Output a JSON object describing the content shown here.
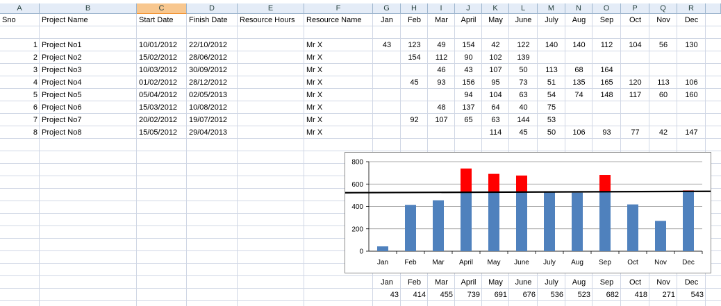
{
  "columns": [
    "A",
    "B",
    "C",
    "D",
    "E",
    "F",
    "G",
    "H",
    "I",
    "J",
    "K",
    "L",
    "M",
    "N",
    "O",
    "P",
    "Q",
    "R"
  ],
  "selected_column": "C",
  "header_row": [
    "Sno",
    "Project Name",
    "Start Date",
    "Finish Date",
    "Resource Hours",
    "Resource Name",
    "Jan",
    "Feb",
    "Mar",
    "April",
    "May",
    "June",
    "July",
    "Aug",
    "Sep",
    "Oct",
    "Nov",
    "Dec"
  ],
  "rows": [
    {
      "sno": "1",
      "name": "Project No1",
      "start": "10/01/2012",
      "finish": "22/10/2012",
      "res": "Mr X",
      "months": [
        "43",
        "123",
        "49",
        "154",
        "42",
        "122",
        "140",
        "140",
        "112",
        "104",
        "56",
        "130"
      ]
    },
    {
      "sno": "2",
      "name": "Project No2",
      "start": "15/02/2012",
      "finish": "28/06/2012",
      "res": "Mr X",
      "months": [
        "",
        "154",
        "112",
        "90",
        "102",
        "139",
        "",
        "",
        "",
        "",
        "",
        ""
      ]
    },
    {
      "sno": "3",
      "name": "Project No3",
      "start": "10/03/2012",
      "finish": "30/09/2012",
      "res": "Mr X",
      "months": [
        "",
        "",
        "46",
        "43",
        "107",
        "50",
        "113",
        "68",
        "164",
        "",
        "",
        ""
      ]
    },
    {
      "sno": "4",
      "name": "Project No4",
      "start": "01/02/2012",
      "finish": "28/12/2012",
      "res": "Mr X",
      "months": [
        "",
        "45",
        "93",
        "156",
        "95",
        "73",
        "51",
        "135",
        "165",
        "120",
        "113",
        "106"
      ]
    },
    {
      "sno": "5",
      "name": "Project No5",
      "start": "05/04/2012",
      "finish": "02/05/2013",
      "res": "Mr X",
      "months": [
        "",
        "",
        "",
        "94",
        "104",
        "63",
        "54",
        "74",
        "148",
        "117",
        "60",
        "160"
      ]
    },
    {
      "sno": "6",
      "name": "Project No6",
      "start": "15/03/2012",
      "finish": "10/08/2012",
      "res": "Mr X",
      "months": [
        "",
        "",
        "48",
        "137",
        "64",
        "40",
        "75",
        "",
        "",
        "",
        "",
        ""
      ]
    },
    {
      "sno": "7",
      "name": "Project No7",
      "start": "20/02/2012",
      "finish": "19/07/2012",
      "res": "Mr X",
      "months": [
        "",
        "92",
        "107",
        "65",
        "63",
        "144",
        "53",
        "",
        "",
        "",
        "",
        ""
      ]
    },
    {
      "sno": "8",
      "name": "Project No8",
      "start": "15/05/2012",
      "finish": "29/04/2013",
      "res": "Mr X",
      "months": [
        "",
        "",
        "",
        "",
        "114",
        "45",
        "50",
        "106",
        "93",
        "77",
        "42",
        "147"
      ]
    }
  ],
  "totals_labels": [
    "Jan",
    "Feb",
    "Mar",
    "April",
    "May",
    "June",
    "July",
    "Aug",
    "Sep",
    "Oct",
    "Nov",
    "Dec"
  ],
  "totals_values": [
    "43",
    "414",
    "455",
    "739",
    "691",
    "676",
    "536",
    "523",
    "682",
    "418",
    "271",
    "543"
  ],
  "colors": {
    "bar": "#4f81bd",
    "over": "#ff0000",
    "threshold_line": "#000000",
    "header_bg": "#e4ecf7",
    "selected_header": "#f8c78f"
  },
  "chart_data": {
    "type": "bar",
    "categories": [
      "Jan",
      "Feb",
      "Mar",
      "April",
      "May",
      "June",
      "July",
      "Aug",
      "Sep",
      "Oct",
      "Nov",
      "Dec"
    ],
    "values": [
      43,
      414,
      455,
      739,
      691,
      676,
      536,
      523,
      682,
      418,
      271,
      543
    ],
    "threshold": 530,
    "ylim": [
      0,
      800
    ],
    "yticks": [
      "0",
      "200",
      "400",
      "600",
      "800"
    ],
    "grid": true,
    "legend": "none",
    "title": "",
    "xlabel": "",
    "ylabel": ""
  }
}
